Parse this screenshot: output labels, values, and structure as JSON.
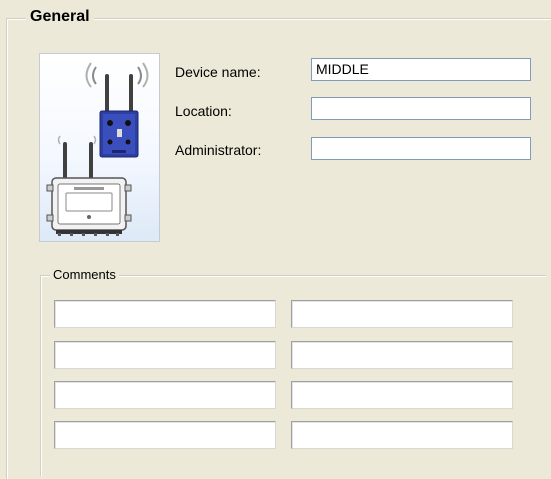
{
  "group": {
    "title": "General"
  },
  "device": {
    "picture_icon": "access-point-devices-icon"
  },
  "fields": {
    "device_name": {
      "label": "Device name:",
      "value": "MIDDLE"
    },
    "location": {
      "label": "Location:",
      "value": ""
    },
    "administrator": {
      "label": "Administrator:",
      "value": ""
    }
  },
  "comments": {
    "title": "Comments",
    "lines": [
      "",
      "",
      "",
      "",
      "",
      "",
      "",
      ""
    ]
  }
}
